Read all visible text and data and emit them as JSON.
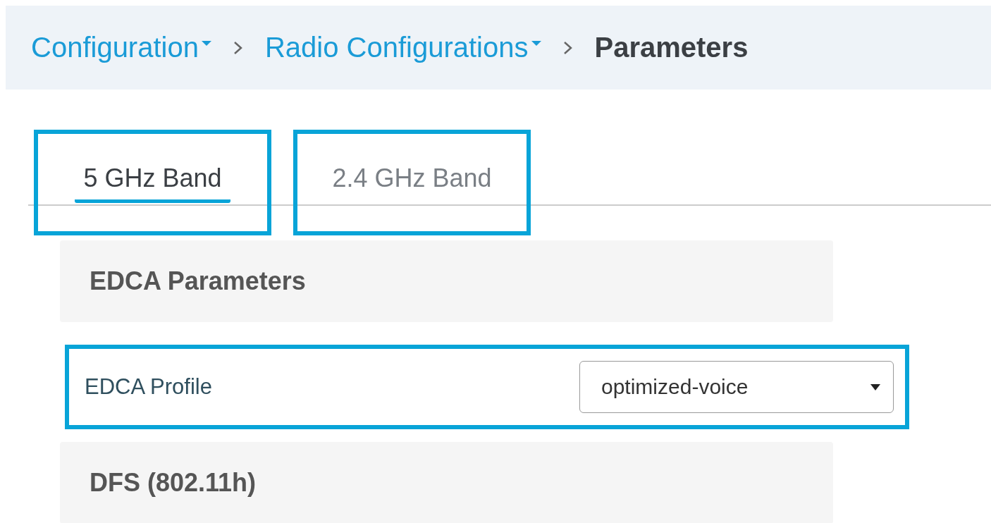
{
  "breadcrumb": [
    {
      "label": "Configuration",
      "kind": "dropdown"
    },
    {
      "label": "Radio Configurations",
      "kind": "dropdown"
    },
    {
      "label": "Parameters",
      "kind": "current"
    }
  ],
  "tabs": [
    {
      "label": "5 GHz Band",
      "selected": true,
      "highlighted": true
    },
    {
      "label": "2.4 GHz Band",
      "selected": false,
      "highlighted": true
    }
  ],
  "sections": [
    {
      "kind": "header",
      "title": "EDCA Parameters"
    },
    {
      "kind": "field",
      "label": "EDCA Profile",
      "value": "optimized-voice",
      "highlighted": true
    },
    {
      "kind": "header",
      "title": "DFS (802.11h)"
    }
  ]
}
